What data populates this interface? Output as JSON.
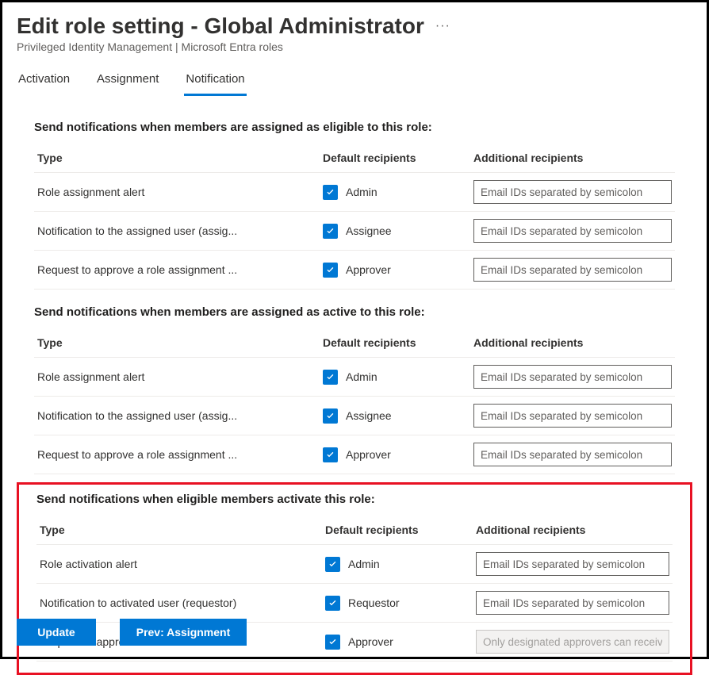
{
  "header": {
    "title": "Edit role setting - Global Administrator",
    "subtitle": "Privileged Identity Management | Microsoft Entra roles"
  },
  "tabs": [
    {
      "label": "Activation",
      "active": false
    },
    {
      "label": "Assignment",
      "active": false
    },
    {
      "label": "Notification",
      "active": true
    }
  ],
  "tableHeaders": {
    "type": "Type",
    "default": "Default recipients",
    "additional": "Additional recipients"
  },
  "sections": [
    {
      "title": "Send notifications when members are assigned as eligible to this role:",
      "highlighted": false,
      "rows": [
        {
          "type": "Role assignment alert",
          "recipientLabel": "Admin",
          "checked": true,
          "placeholder": "Email IDs separated by semicolon",
          "disabled": false
        },
        {
          "type": "Notification to the assigned user (assig...",
          "recipientLabel": "Assignee",
          "checked": true,
          "placeholder": "Email IDs separated by semicolon",
          "disabled": false
        },
        {
          "type": "Request to approve a role assignment ...",
          "recipientLabel": "Approver",
          "checked": true,
          "placeholder": "Email IDs separated by semicolon",
          "disabled": false
        }
      ]
    },
    {
      "title": "Send notifications when members are assigned as active to this role:",
      "highlighted": false,
      "rows": [
        {
          "type": "Role assignment alert",
          "recipientLabel": "Admin",
          "checked": true,
          "placeholder": "Email IDs separated by semicolon",
          "disabled": false
        },
        {
          "type": "Notification to the assigned user (assig...",
          "recipientLabel": "Assignee",
          "checked": true,
          "placeholder": "Email IDs separated by semicolon",
          "disabled": false
        },
        {
          "type": "Request to approve a role assignment ...",
          "recipientLabel": "Approver",
          "checked": true,
          "placeholder": "Email IDs separated by semicolon",
          "disabled": false
        }
      ]
    },
    {
      "title": "Send notifications when eligible members activate this role:",
      "highlighted": true,
      "rows": [
        {
          "type": "Role activation alert",
          "recipientLabel": "Admin",
          "checked": true,
          "placeholder": "Email IDs separated by semicolon",
          "disabled": false
        },
        {
          "type": "Notification to activated user (requestor)",
          "recipientLabel": "Requestor",
          "checked": true,
          "placeholder": "Email IDs separated by semicolon",
          "disabled": false
        },
        {
          "type": "Request to approve an activation",
          "recipientLabel": "Approver",
          "checked": true,
          "placeholder": "Only designated approvers can receive...",
          "disabled": true
        }
      ]
    }
  ],
  "footer": {
    "update": "Update",
    "prev": "Prev: Assignment"
  }
}
